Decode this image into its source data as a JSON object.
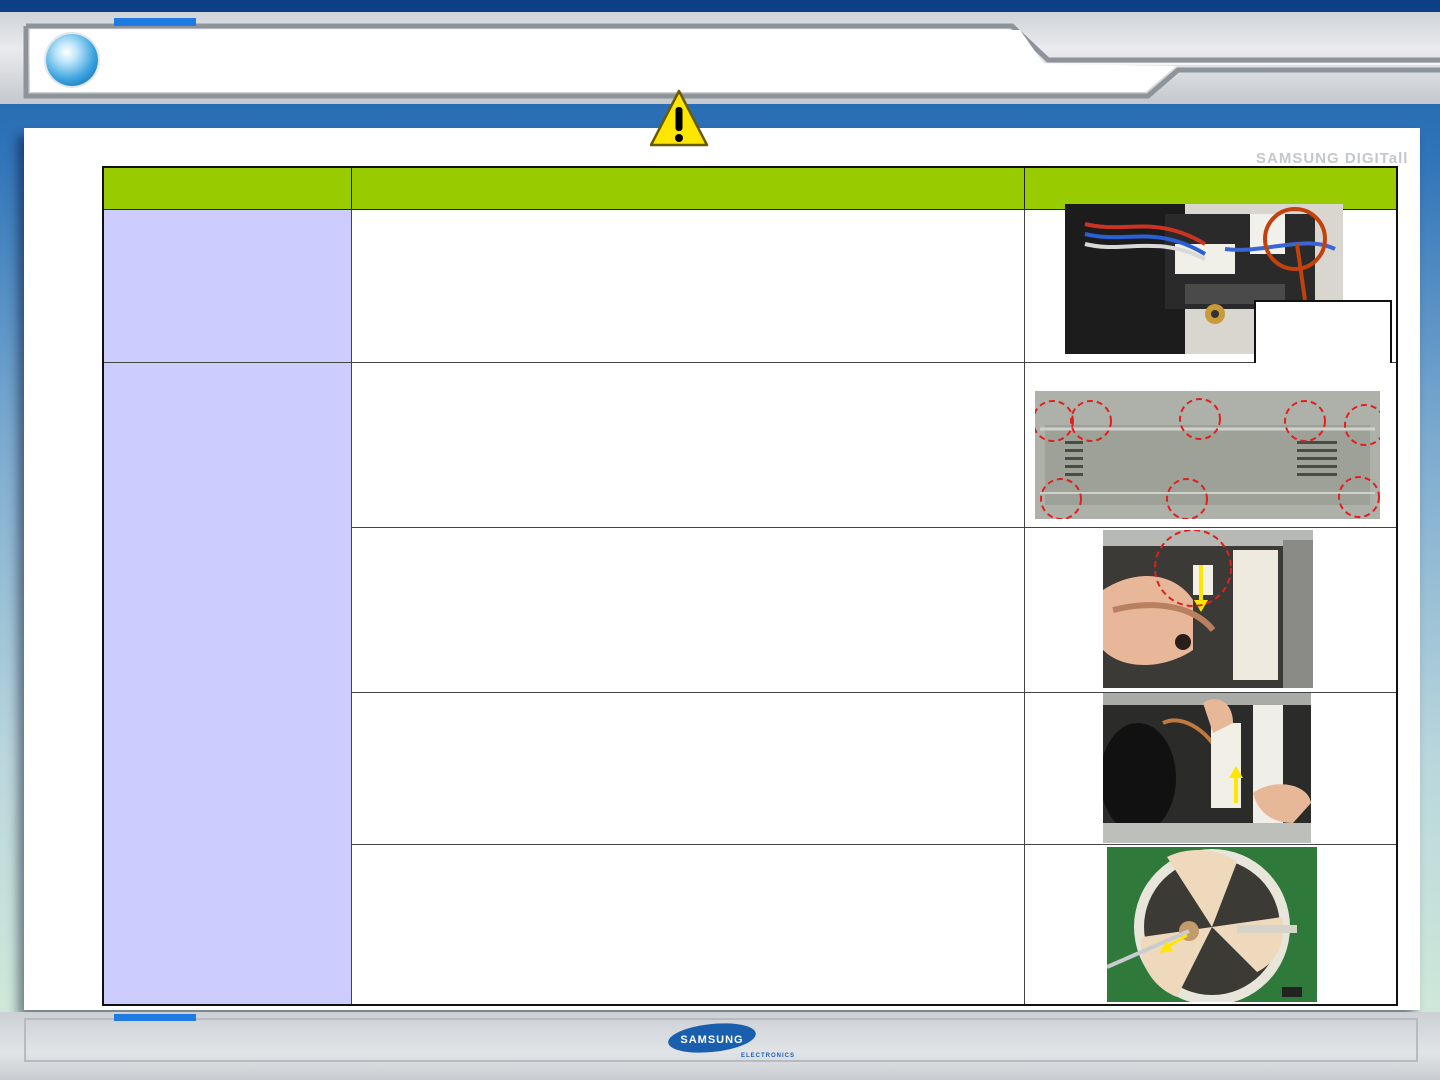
{
  "header": {
    "title": "",
    "accent_color": "#1f7be0",
    "orb_icon": "globe-orb-icon"
  },
  "warning": {
    "icon": "warning-triangle-icon",
    "color": "#ffe600"
  },
  "watermark": {
    "text": "SAMSUNG DIGITall"
  },
  "table": {
    "header_color": "#99cc00",
    "category_color": "#ccccff",
    "columns": [
      "",
      "",
      ""
    ],
    "rows": [
      {
        "category": "",
        "description": "",
        "photo": "wire-harness-connector-photo",
        "callout": ""
      },
      {
        "category": "",
        "description": "",
        "photo": "rear-cover-screws-photo"
      },
      {
        "category": "",
        "description": "",
        "photo": "disconnect-fan-motor-wire-photo"
      },
      {
        "category": "",
        "description": "",
        "photo": "lift-fan-bracket-photo"
      },
      {
        "category": "",
        "description": "",
        "photo": "remove-fan-blade-photo"
      }
    ]
  },
  "footer": {
    "logo_text": "SAMSUNG",
    "logo_subtext": "ELECTRONICS",
    "logo_color": "#1a5fae"
  }
}
